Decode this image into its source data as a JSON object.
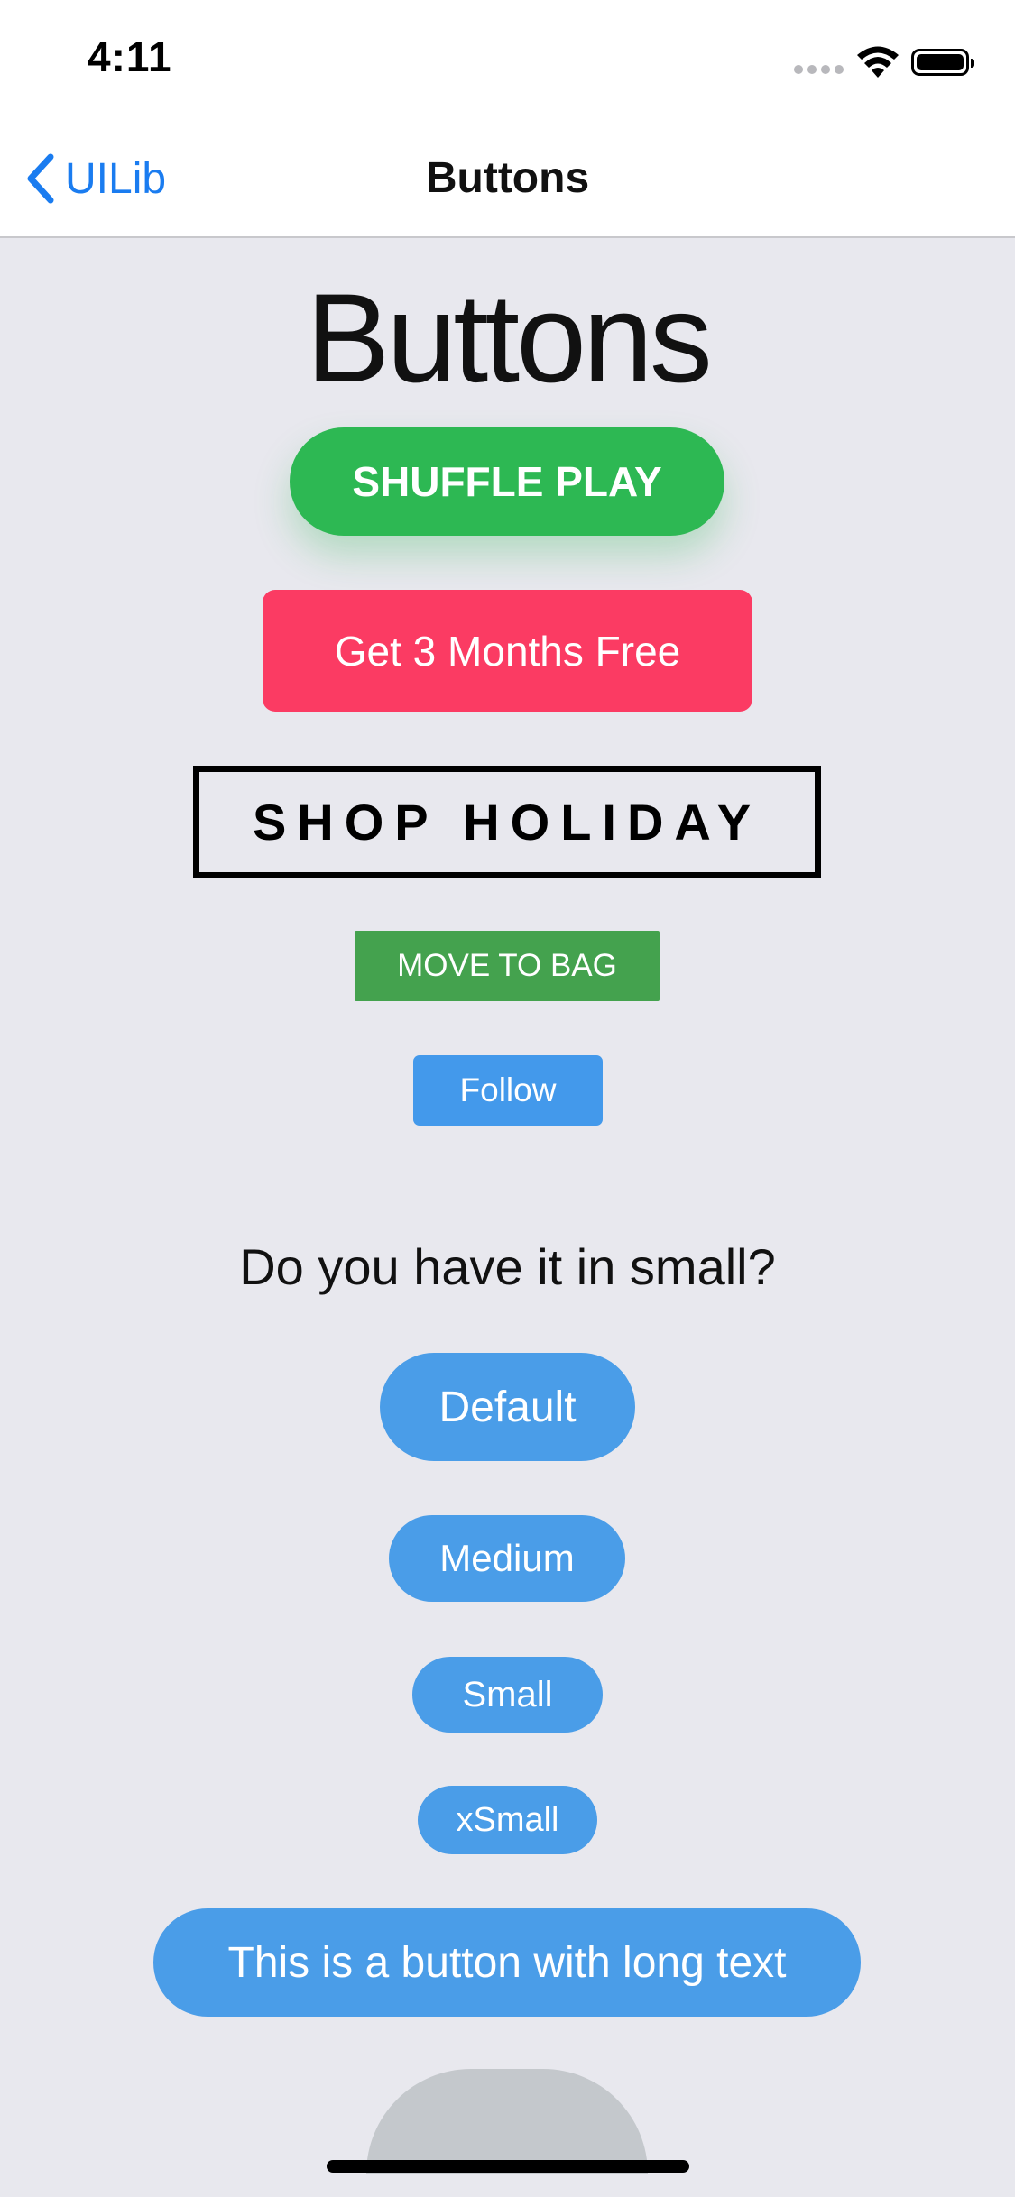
{
  "status_bar": {
    "time": "4:11",
    "icons": [
      "signal-icon",
      "wifi-icon",
      "battery-icon"
    ]
  },
  "nav": {
    "back_label": "UILib",
    "title": "Buttons",
    "accent_color": "#1a7cf0"
  },
  "main": {
    "heading": "Buttons",
    "buttons": {
      "shuffle": "SHUFFLE PLAY",
      "free": "Get 3 Months Free",
      "shop": "SHOP HOLIDAY",
      "bag": "MOVE TO BAG",
      "follow": "Follow"
    },
    "size_question": "Do you have it in small?",
    "sizes": {
      "default": "Default",
      "medium": "Medium",
      "small": "Small",
      "xsmall": "xSmall",
      "long": "This is a button with long text"
    }
  },
  "colors": {
    "shuffle_green": "#2db853",
    "free_red": "#fb3b63",
    "bag_green": "#44a24e",
    "follow_blue": "#4399eb",
    "pill_blue": "#4a9de8",
    "disabled_gray": "#c4c8cc",
    "background": "#e8e8ee"
  }
}
